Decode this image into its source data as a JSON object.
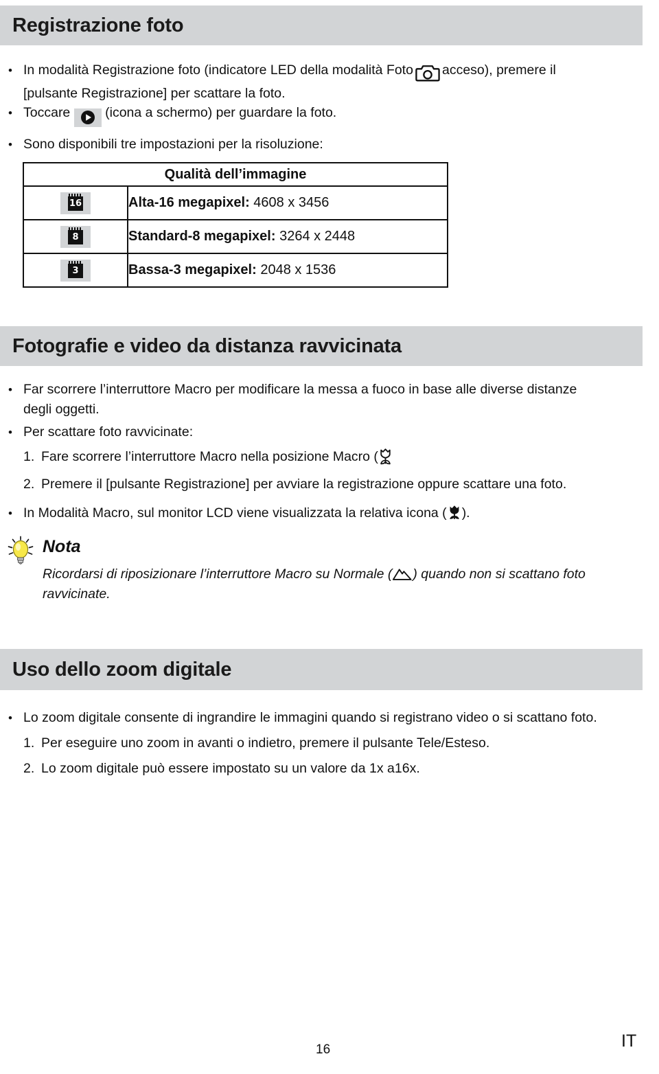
{
  "page": {
    "number": "16",
    "language_code": "IT"
  },
  "sections": [
    {
      "id": "registrazione-foto",
      "title": "Registrazione foto"
    },
    {
      "id": "fotografie-video-ravvicinata",
      "title": "Fotografie e video da distanza ravvicinata"
    },
    {
      "id": "zoom-digitale",
      "title": "Uso dello zoom digitale"
    }
  ],
  "section1": {
    "bullet1_part1": "In modalità Registrazione foto (indicatore LED della modalità Foto",
    "bullet1_part2": "acceso), premere il",
    "bullet1_line2": "[pulsante Registrazione] per scattare la foto.",
    "bullet2_part1": "Toccare",
    "bullet2_part2": "(icona a schermo) per guardare la foto.",
    "bullet3": "Sono disponibili tre impostazioni per la risoluzione:",
    "icons": {
      "camera": "camera-icon",
      "play": "play-icon"
    }
  },
  "res_table": {
    "header": "Qualità dell’immagine",
    "rows": [
      {
        "badge": "16",
        "label_bold": "Alta-16 megapixel:",
        "label_rest": "4608 x 3456"
      },
      {
        "badge": "8",
        "label_bold": "Standard-8 megapixel:",
        "label_rest": "3264 x 2448"
      },
      {
        "badge": "3",
        "label_bold": "Bassa-3 megapixel:",
        "label_rest": "2048 x 1536"
      }
    ]
  },
  "section2": {
    "bullet1_line1": "Far scorrere l’interruttore Macro per modificare la messa a fuoco in base alle diverse distanze",
    "bullet1_line2": "degli oggetti.",
    "bullet2": "Per scattare foto ravvicinate:",
    "step1_num": "1.",
    "step1_text": "Fare scorrere l’interruttore Macro nella posizione Macro (",
    "step2_num": "2.",
    "step2_text": "Premere il [pulsante Registrazione] per avviare la registrazione oppure scattare una foto.",
    "bullet3_part1": "In Modalità Macro, sul monitor LCD viene visualizzata la relativa icona (",
    "bullet3_part2": ").",
    "icons": {
      "tulip_outline": "tulip-outline-icon",
      "tulip_filled": "tulip-filled-icon"
    }
  },
  "nota": {
    "title": "Nota",
    "body_part1": "Ricordarsi di riposizionare l’interruttore Macro su Normale (",
    "body_part2": ") quando non si scattano foto",
    "body_line2": "ravvicinate.",
    "icons": {
      "bulb": "lightbulb-icon",
      "mountain": "mountain-icon"
    }
  },
  "section3": {
    "bullet1": "Lo zoom digitale consente di ingrandire le immagini quando si registrano video o si scattano foto.",
    "step1_num": "1.",
    "step1_text": "Per eseguire uno zoom in avanti o indietro, premere il pulsante Tele/Esteso.",
    "step2_num": "2.",
    "step2_text": "Lo zoom digitale può essere impostato su un valore da 1x a16x."
  },
  "colors": {
    "band_gray": "#d2d4d6",
    "text": "#111111",
    "bulb_yellow": "#f5e441"
  }
}
